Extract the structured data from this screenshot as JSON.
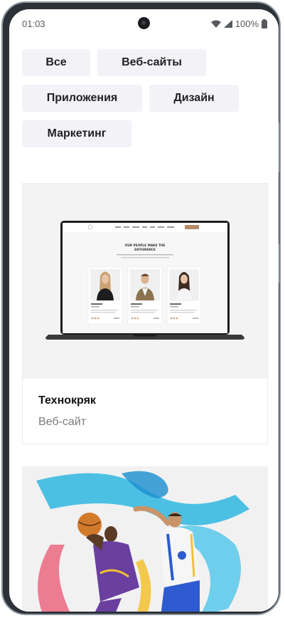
{
  "status": {
    "time": "01:03",
    "battery": "100%"
  },
  "filters": [
    "Все",
    "Веб-сайты",
    "Приложения",
    "Дизайн",
    "Маркетинг"
  ],
  "cards": [
    {
      "title": "Технокряк",
      "category": "Веб-сайт",
      "preview_heading": "OUR PEOPLE MAKE THE DIFFERENCE"
    }
  ],
  "colors": {
    "chip_bg": "#f2f2f7",
    "accent_button": "#b68b6a",
    "frame": "#2c3138"
  }
}
